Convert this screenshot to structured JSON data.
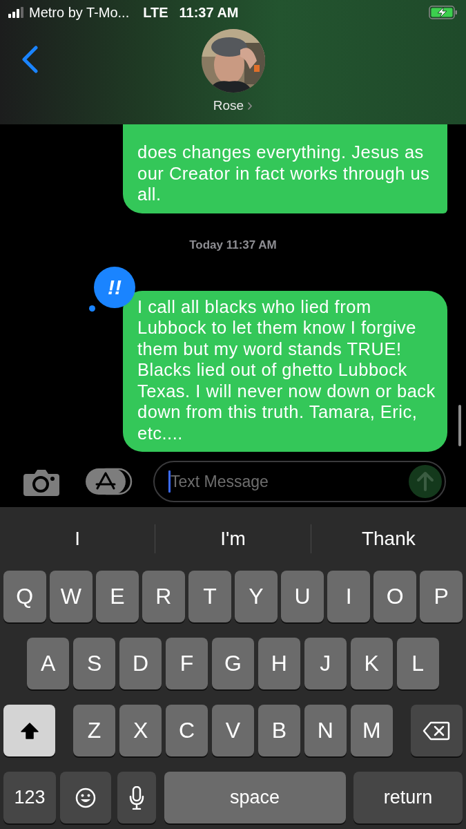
{
  "status_bar": {
    "carrier": "Metro by T-Mo...",
    "network": "LTE",
    "time": "11:37 AM",
    "charging": true
  },
  "header": {
    "contact": "Rose"
  },
  "messages": [
    {
      "kind": "bubble",
      "text": "does changes everything. Jesus as our Creator in fact works through us all.",
      "tail": true
    },
    {
      "kind": "timestamp",
      "text": "Today 11:37 AM"
    },
    {
      "kind": "bubble",
      "text": "I call all blacks who lied from Lubbock to let them know I forgive them but my word stands TRUE! Blacks lied out of ghetto Lubbock Texas. I will never now down or back down from this truth. Tamara, Eric, etc....",
      "tail": false,
      "reaction": "!!"
    }
  ],
  "composer": {
    "placeholder": "Text Message"
  },
  "keyboard": {
    "suggestions": [
      "I",
      "I'm",
      "Thank"
    ],
    "rows": [
      {
        "keys": [
          {
            "kind": "letter",
            "label": "Q"
          },
          {
            "kind": "letter",
            "label": "W"
          },
          {
            "kind": "letter",
            "label": "E"
          },
          {
            "kind": "letter",
            "label": "R"
          },
          {
            "kind": "letter",
            "label": "T"
          },
          {
            "kind": "letter",
            "label": "Y"
          },
          {
            "kind": "letter",
            "label": "U"
          },
          {
            "kind": "letter",
            "label": "I"
          },
          {
            "kind": "letter",
            "label": "O"
          },
          {
            "kind": "letter",
            "label": "P"
          }
        ]
      },
      {
        "keys": [
          {
            "kind": "letter",
            "label": "A"
          },
          {
            "kind": "letter",
            "label": "S"
          },
          {
            "kind": "letter",
            "label": "D"
          },
          {
            "kind": "letter",
            "label": "F"
          },
          {
            "kind": "letter",
            "label": "G"
          },
          {
            "kind": "letter",
            "label": "H"
          },
          {
            "kind": "letter",
            "label": "J"
          },
          {
            "kind": "letter",
            "label": "K"
          },
          {
            "kind": "letter",
            "label": "L"
          }
        ]
      },
      {
        "keys": [
          {
            "kind": "shift",
            "on": true
          },
          {
            "kind": "letter",
            "label": "Z"
          },
          {
            "kind": "letter",
            "label": "X"
          },
          {
            "kind": "letter",
            "label": "C"
          },
          {
            "kind": "letter",
            "label": "V"
          },
          {
            "kind": "letter",
            "label": "B"
          },
          {
            "kind": "letter",
            "label": "N"
          },
          {
            "kind": "letter",
            "label": "M"
          },
          {
            "kind": "delete"
          }
        ]
      },
      {
        "keys": [
          {
            "kind": "numbers",
            "label": "123"
          },
          {
            "kind": "emoji"
          },
          {
            "kind": "mic"
          },
          {
            "kind": "space",
            "label": "space"
          },
          {
            "kind": "return",
            "label": "return"
          }
        ]
      }
    ]
  }
}
